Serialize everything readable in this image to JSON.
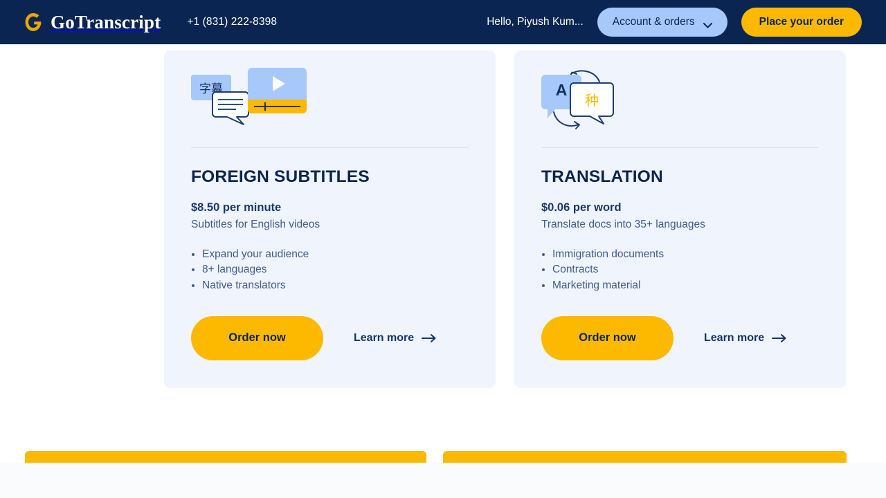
{
  "header": {
    "brand_name": "GoTranscript",
    "logo_icon": "g-logo-icon",
    "phone": "+1 (831) 222-8398",
    "greeting": "Hello, Piyush Kum...",
    "account_button": "Account & orders",
    "account_chevron_icon": "chevron-down-icon",
    "place_order_button": "Place your order",
    "background_color": "#0a2551",
    "accent_color": "#fcb900",
    "light_blue": "#a7c8fb"
  },
  "cards": [
    {
      "id": "foreign-subtitles",
      "title": "FOREIGN SUBTITLES",
      "price": "$8.50 per minute",
      "subtitle": "Subtitles for English videos",
      "features": [
        "Expand your audience",
        "8+ languages",
        "Native translators"
      ],
      "cta_label": "Order now",
      "learn_more_label": "Learn more",
      "learn_more_icon": "arrow-right-icon",
      "icon": {
        "name": "subtitles-video-icon",
        "chip_text": "字幕",
        "bubble_icon": "speech-bubble-lines-icon",
        "player_icon": "video-player-play-icon"
      }
    },
    {
      "id": "translation",
      "title": "TRANSLATION",
      "price": "$0.06 per word",
      "subtitle": "Translate docs into 35+ languages",
      "features": [
        "Immigration documents",
        "Contracts",
        "Marketing material"
      ],
      "cta_label": "Order now",
      "learn_more_label": "Learn more",
      "learn_more_icon": "arrow-right-icon",
      "icon": {
        "name": "translation-bubbles-icon",
        "bubble_a_text": "A",
        "bubble_b_text": "种",
        "arrows_icon": "rotate-arrows-icon"
      }
    }
  ],
  "bottom": {
    "bar_color": "#fcb900",
    "panel_color": "#fafbfd"
  }
}
